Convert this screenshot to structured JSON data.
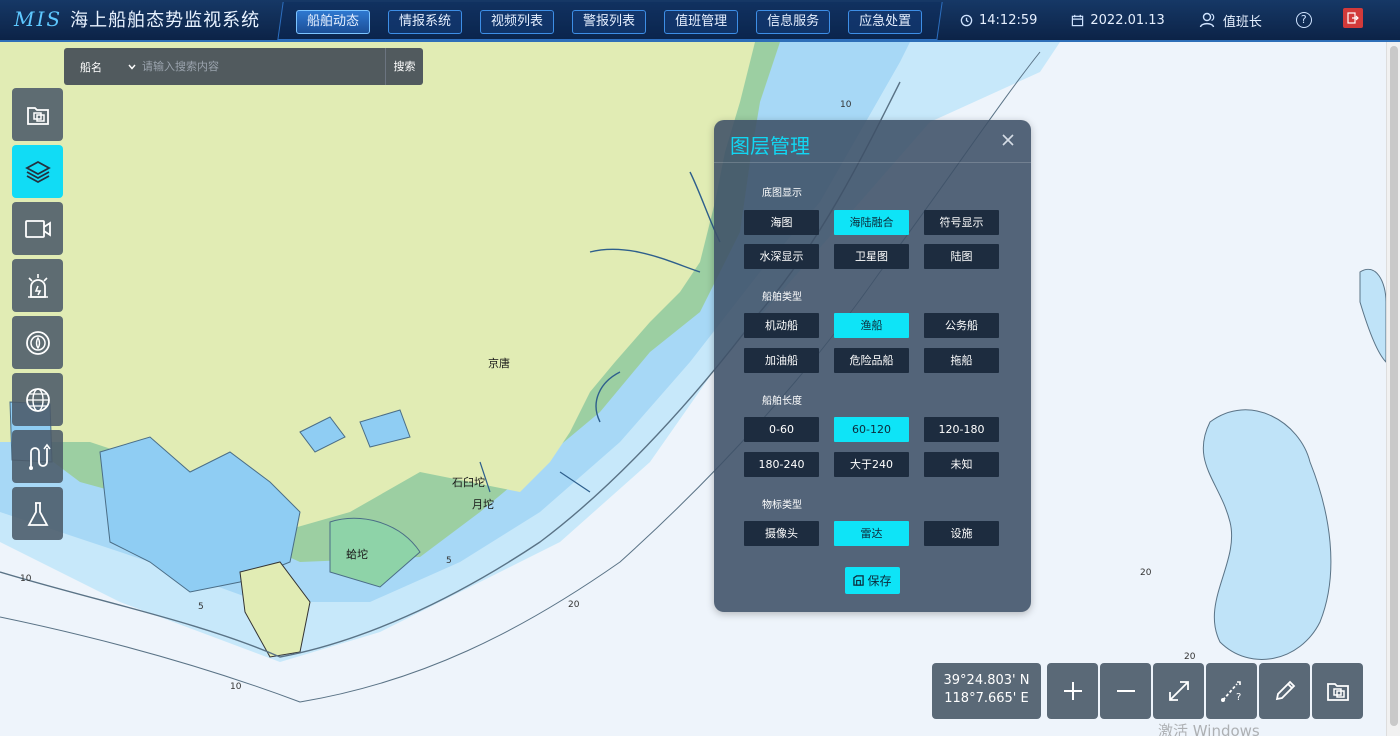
{
  "header": {
    "logo_mis": "MIS",
    "title": "海上船舶态势监视系统",
    "nav": [
      {
        "label": "船舶动态",
        "active": true
      },
      {
        "label": "情报系统",
        "active": false
      },
      {
        "label": "视频列表",
        "active": false
      },
      {
        "label": "警报列表",
        "active": false
      },
      {
        "label": "值班管理",
        "active": false
      },
      {
        "label": "信息服务",
        "active": false
      },
      {
        "label": "应急处置",
        "active": false
      }
    ],
    "time": "14:12:59",
    "date": "2022.01.13",
    "user": "值班长",
    "help_icon": "help-icon",
    "exit_icon": "exit-icon"
  },
  "search": {
    "type_value": "船名",
    "placeholder": "请输入搜索内容",
    "button_label": "搜索"
  },
  "left_tools": [
    {
      "name": "layer-select-icon",
      "active": false
    },
    {
      "name": "layers-icon",
      "active": true
    },
    {
      "name": "video-icon",
      "active": false
    },
    {
      "name": "alarm-icon",
      "active": false
    },
    {
      "name": "target-icon",
      "active": false
    },
    {
      "name": "globe-icon",
      "active": false
    },
    {
      "name": "track-icon",
      "active": false
    },
    {
      "name": "flask-icon",
      "active": false
    }
  ],
  "layer_panel": {
    "title": "图层管理",
    "sections": [
      {
        "label": "底图显示",
        "options": [
          {
            "label": "海图",
            "on": false
          },
          {
            "label": "海陆融合",
            "on": true
          },
          {
            "label": "符号显示",
            "on": false
          },
          {
            "label": "水深显示",
            "on": false
          },
          {
            "label": "卫星图",
            "on": false
          },
          {
            "label": "陆图",
            "on": false
          }
        ]
      },
      {
        "label": "船舶类型",
        "options": [
          {
            "label": "机动船",
            "on": false
          },
          {
            "label": "渔船",
            "on": true
          },
          {
            "label": "公务船",
            "on": false
          },
          {
            "label": "加油船",
            "on": false
          },
          {
            "label": "危险品船",
            "on": false
          },
          {
            "label": "拖船",
            "on": false
          }
        ]
      },
      {
        "label": "船舶长度",
        "options": [
          {
            "label": "0-60",
            "on": false
          },
          {
            "label": "60-120",
            "on": true
          },
          {
            "label": "120-180",
            "on": false
          },
          {
            "label": "180-240",
            "on": false
          },
          {
            "label": "大于240",
            "on": false
          },
          {
            "label": "未知",
            "on": false
          }
        ]
      },
      {
        "label": "物标类型",
        "options": [
          {
            "label": "摄像头",
            "on": false
          },
          {
            "label": "雷达",
            "on": true
          },
          {
            "label": "设施",
            "on": false
          }
        ]
      }
    ],
    "save_label": "保存"
  },
  "coordinates": {
    "lat": "39°24.803' N",
    "lon": "118°7.665' E"
  },
  "map_controls": [
    "zoom-in-icon",
    "zoom-out-icon",
    "fullscreen-icon",
    "measure-icon",
    "draw-icon",
    "layer-select-icon"
  ],
  "map_labels": {
    "place_1": "京唐",
    "place_2": "石臼坨",
    "place_3": "月坨",
    "place_4": "蛤坨"
  },
  "depth_labels": [
    "10",
    "10",
    "5",
    "5",
    "10",
    "20",
    "20",
    "20"
  ],
  "watermark": "激活 Windows",
  "colors": {
    "land": "#e1ecb4",
    "shallow_green": "#9ccfa2",
    "water_light": "#bfe3f8",
    "water_mid": "#a2d6f5",
    "deep_sea": "#eef4fb",
    "accent_cyan": "#0ee4f7"
  }
}
